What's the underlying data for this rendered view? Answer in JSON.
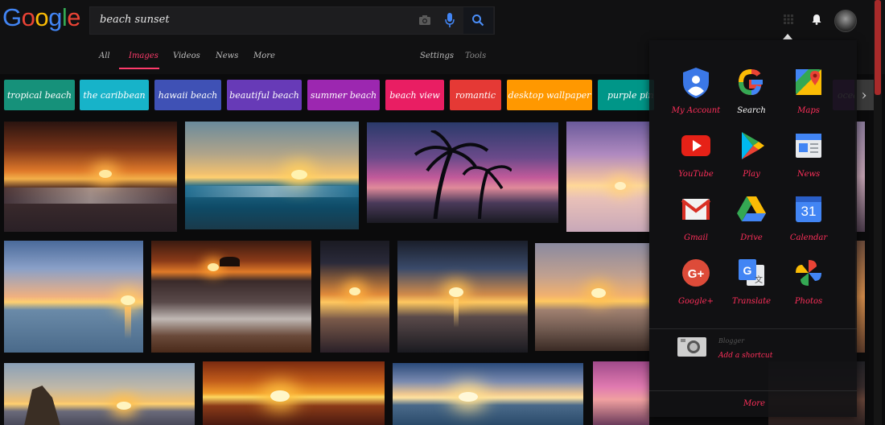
{
  "logo": {
    "letters": [
      {
        "ch": "G",
        "color": "#4285F4"
      },
      {
        "ch": "o",
        "color": "#EA4335"
      },
      {
        "ch": "o",
        "color": "#FBBC05"
      },
      {
        "ch": "g",
        "color": "#4285F4"
      },
      {
        "ch": "l",
        "color": "#34A853"
      },
      {
        "ch": "e",
        "color": "#EA4335"
      }
    ]
  },
  "search": {
    "query": "beach sunset"
  },
  "nav": {
    "all": "All",
    "images": "Images",
    "videos": "Videos",
    "news": "News",
    "more": "More",
    "settings": "Settings",
    "tools": "Tools"
  },
  "chips": [
    {
      "label": "tropical beach",
      "color": "#16917a"
    },
    {
      "label": "the caribbean",
      "color": "#17b3c9"
    },
    {
      "label": "hawaii beach",
      "color": "#3f51b5"
    },
    {
      "label": "beautiful beach",
      "color": "#673ab7"
    },
    {
      "label": "summer beach",
      "color": "#9c27b0"
    },
    {
      "label": "beach view",
      "color": "#e91e63"
    },
    {
      "label": "romantic",
      "color": "#e53935"
    },
    {
      "label": "desktop wallpaper",
      "color": "#ff9800"
    },
    {
      "label": "purple pink",
      "color": "#009688"
    },
    {
      "label": "ocean",
      "color": "#7b1fa2"
    }
  ],
  "apps_panel": {
    "apps": [
      {
        "label": "My Account",
        "icon": "account-icon"
      },
      {
        "label": "Search",
        "icon": "google-g-icon"
      },
      {
        "label": "Maps",
        "icon": "maps-icon"
      },
      {
        "label": "YouTube",
        "icon": "youtube-icon"
      },
      {
        "label": "Play",
        "icon": "play-store-icon"
      },
      {
        "label": "News",
        "icon": "news-icon"
      },
      {
        "label": "Gmail",
        "icon": "gmail-icon"
      },
      {
        "label": "Drive",
        "icon": "drive-icon"
      },
      {
        "label": "Calendar",
        "icon": "calendar-icon"
      },
      {
        "label": "Google+",
        "icon": "google-plus-icon"
      },
      {
        "label": "Translate",
        "icon": "translate-icon"
      },
      {
        "label": "Photos",
        "icon": "photos-icon"
      }
    ],
    "calendar_day": "31",
    "shortcut_small": "Blogger",
    "shortcut_label": "Add a shortcut",
    "more": "More"
  },
  "colors": {
    "accent": "#ff3b6b",
    "background": "#0b0b0c"
  }
}
